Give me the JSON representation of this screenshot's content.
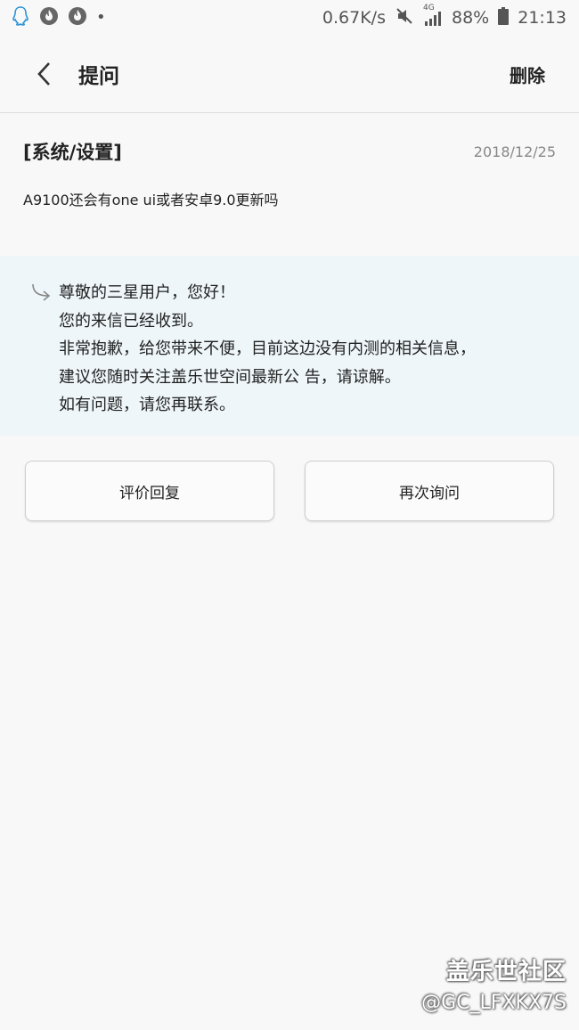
{
  "status_bar": {
    "speed": "0.67K/s",
    "network": "4G",
    "battery": "88%",
    "time": "21:13",
    "icons": [
      "qq-icon",
      "app-icon",
      "app-icon",
      "dot",
      "mute-icon",
      "signal-icon",
      "battery-icon"
    ]
  },
  "app_bar": {
    "title": "提问",
    "delete_label": "删除"
  },
  "question": {
    "category": "[系统/设置]",
    "date": "2018/12/25",
    "text": "A9100还会有one ui或者安卓9.0更新吗"
  },
  "reply": {
    "lines": [
      "尊敬的三星用户，您好！",
      "您的来信已经收到。",
      "非常抱歉，给您带来不便，目前这边没有内测的相关信息，",
      "建议您随时关注盖乐世空间最新公 告，请谅解。",
      "如有问题，请您再联系。"
    ]
  },
  "actions": {
    "rate_label": "评价回复",
    "ask_again_label": "再次询问"
  },
  "watermark": {
    "title": "盖乐世社区",
    "handle": "@GC_LFXKX7S"
  },
  "colors": {
    "background": "#f8f8f8",
    "reply_background": "#eef6f9",
    "text": "#222222",
    "muted": "#888888"
  }
}
